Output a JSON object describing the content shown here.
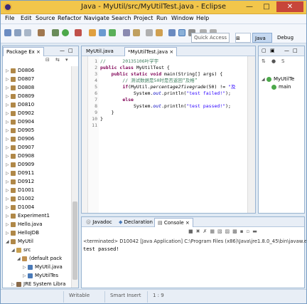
{
  "window": {
    "title": "Java - MyUtil/src/MyUtilTest.java - Eclipse"
  },
  "menu": [
    "File",
    "Edit",
    "Source",
    "Refactor",
    "Navigate",
    "Search",
    "Project",
    "Run",
    "Window",
    "Help"
  ],
  "quick_access": {
    "placeholder": "Quick Access"
  },
  "perspectives": {
    "java": "Java",
    "debug": "Debug"
  },
  "package_explorer": {
    "tab": "Package Ex",
    "items": [
      {
        "label": "D0806",
        "level": 0,
        "icon": "project-icon"
      },
      {
        "label": "D0807",
        "level": 0,
        "icon": "project-icon"
      },
      {
        "label": "D0808",
        "level": 0,
        "icon": "project-icon"
      },
      {
        "label": "D0809",
        "level": 0,
        "icon": "project-icon"
      },
      {
        "label": "D0810",
        "level": 0,
        "icon": "project-icon"
      },
      {
        "label": "D0902",
        "level": 0,
        "icon": "project-icon"
      },
      {
        "label": "D0904",
        "level": 0,
        "icon": "project-icon"
      },
      {
        "label": "D0905",
        "level": 0,
        "icon": "project-icon"
      },
      {
        "label": "D0906",
        "level": 0,
        "icon": "project-icon"
      },
      {
        "label": "D0907",
        "level": 0,
        "icon": "project-icon"
      },
      {
        "label": "D0908",
        "level": 0,
        "icon": "project-icon"
      },
      {
        "label": "D0909",
        "level": 0,
        "icon": "project-icon"
      },
      {
        "label": "D0911",
        "level": 0,
        "icon": "project-icon"
      },
      {
        "label": "D0912",
        "level": 0,
        "icon": "project-icon"
      },
      {
        "label": "D1001",
        "level": 0,
        "icon": "project-icon"
      },
      {
        "label": "D1002",
        "level": 0,
        "icon": "project-icon"
      },
      {
        "label": "D1004",
        "level": 0,
        "icon": "project-icon"
      },
      {
        "label": "Experiment1",
        "level": 0,
        "icon": "project-icon"
      },
      {
        "label": "Hello.java",
        "level": 0,
        "icon": "project-icon"
      },
      {
        "label": "HelloJDB",
        "level": 0,
        "icon": "project-icon"
      },
      {
        "label": "MyUtil",
        "level": 0,
        "icon": "project-icon",
        "expanded": true
      },
      {
        "label": "src",
        "level": 1,
        "icon": "source-folder-icon",
        "expanded": true
      },
      {
        "label": "(default pack",
        "level": 2,
        "icon": "package-icon",
        "expanded": true
      },
      {
        "label": "MyUtil.java",
        "level": 3,
        "icon": "java-file-icon"
      },
      {
        "label": "MyUtilTes",
        "level": 3,
        "icon": "java-file-icon"
      },
      {
        "label": "JRE System Libra",
        "level": 1,
        "icon": "library-icon"
      }
    ]
  },
  "editor": {
    "tabs": [
      "MyUtil.java",
      "*MyUtilTest.java"
    ],
    "lines": [
      {
        "n": "1",
        "parts": [
          {
            "t": "//      20135106叶学宇",
            "c": "cmt"
          }
        ]
      },
      {
        "n": "2",
        "parts": [
          {
            "t": "public ",
            "c": "kw"
          },
          {
            "t": "class ",
            "c": "kw"
          },
          {
            "t": "MyUtilTest {",
            "c": ""
          }
        ]
      },
      {
        "n": "3",
        "parts": [
          {
            "t": "    public ",
            "c": "kw"
          },
          {
            "t": "static ",
            "c": "kw"
          },
          {
            "t": "void ",
            "c": "kw"
          },
          {
            "t": "main(String[] args) {",
            "c": ""
          }
        ]
      },
      {
        "n": "4",
        "parts": [
          {
            "t": "        // 测试数据是50时是否返回“及格”",
            "c": "cmt"
          }
        ]
      },
      {
        "n": "5",
        "parts": [
          {
            "t": "        ",
            "c": ""
          },
          {
            "t": "if",
            "c": "kw"
          },
          {
            "t": "(MyUtil.",
            "c": ""
          },
          {
            "t": "percentage2fivegrade",
            "c": "mth"
          },
          {
            "t": "(50) != ",
            "c": ""
          },
          {
            "t": "\"及",
            "c": "str"
          }
        ]
      },
      {
        "n": "6",
        "parts": [
          {
            "t": "            System.",
            "c": ""
          },
          {
            "t": "out",
            "c": "fld"
          },
          {
            "t": ".println(",
            "c": ""
          },
          {
            "t": "\"test failed!\"",
            "c": "str"
          },
          {
            "t": ");",
            "c": ""
          }
        ]
      },
      {
        "n": "7",
        "parts": [
          {
            "t": "        ",
            "c": ""
          },
          {
            "t": "else",
            "c": "kw"
          }
        ]
      },
      {
        "n": "8",
        "parts": [
          {
            "t": "            System.",
            "c": ""
          },
          {
            "t": "out",
            "c": "fld"
          },
          {
            "t": ".println(",
            "c": ""
          },
          {
            "t": "\"test passed!\"",
            "c": "str"
          },
          {
            "t": ");",
            "c": ""
          }
        ]
      },
      {
        "n": "9",
        "parts": [
          {
            "t": "    }",
            "c": ""
          }
        ]
      },
      {
        "n": "10",
        "parts": [
          {
            "t": "}",
            "c": ""
          }
        ]
      },
      {
        "n": "11",
        "parts": []
      }
    ]
  },
  "outline": {
    "items": [
      {
        "label": "MyUtilTe",
        "level": 0
      },
      {
        "label": "main",
        "level": 1
      }
    ]
  },
  "bottom": {
    "tabs": [
      "Javadoc",
      "Declaration",
      "Console"
    ],
    "active_tab": "Console",
    "console_header": "<terminated> D10042 [Java Application] C:\\Program Files (x86)\\Java\\jre1.8.0_45\\bin\\javaw.e",
    "console_output": "test passed!"
  },
  "status": {
    "writable": "Writable",
    "insert_mode": "Smart Insert",
    "position": "1 : 9"
  },
  "colors": {
    "titlebar": "#f2c64b",
    "close": "#c7463a",
    "keyword": "#7f0055",
    "comment": "#3f7f5f",
    "string": "#2a00ff",
    "field": "#0000c0"
  }
}
